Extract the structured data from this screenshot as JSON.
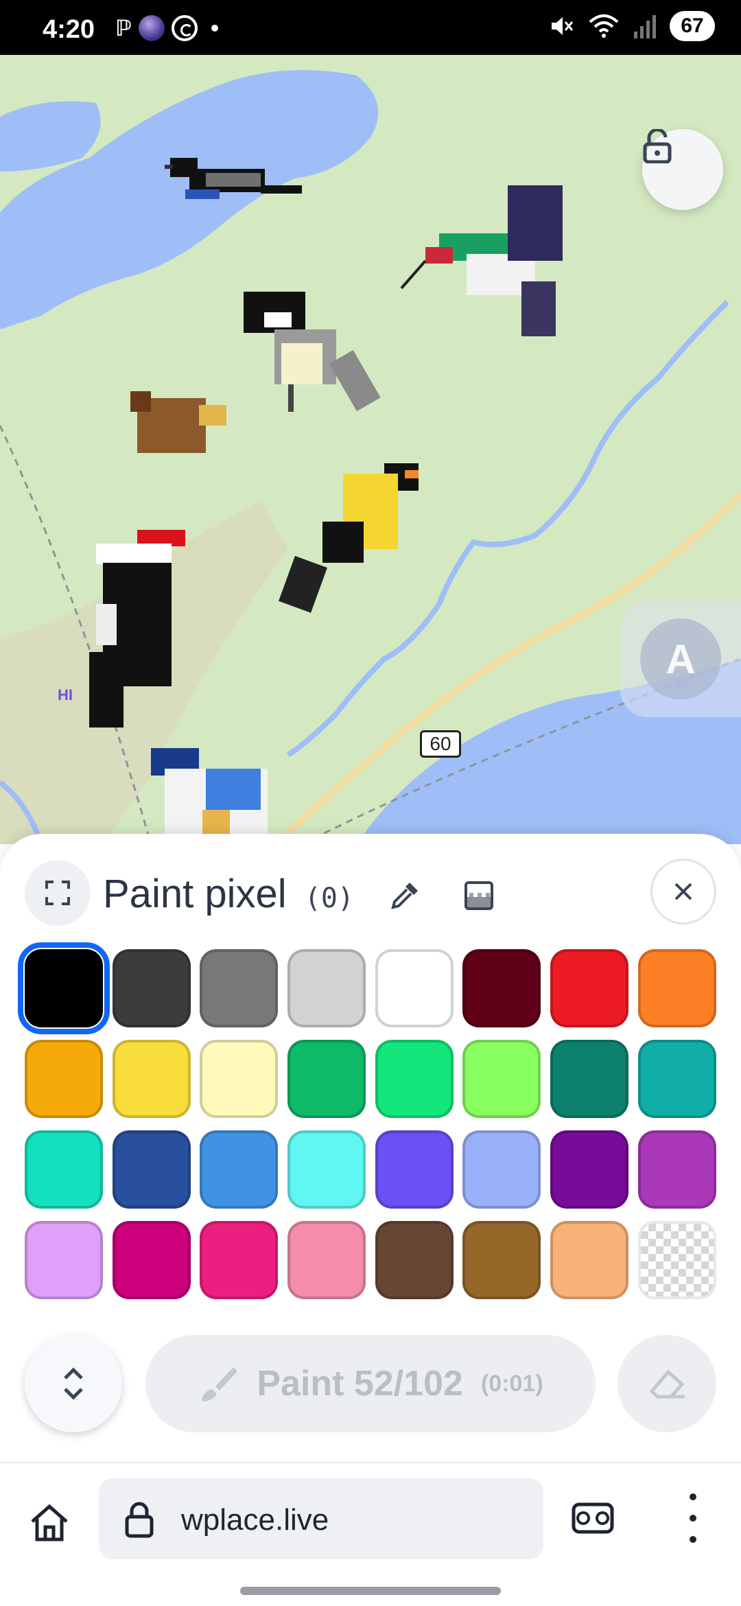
{
  "status_bar": {
    "time": "4:20",
    "left_icons": [
      "parking-icon",
      "globe-app-icon",
      "whatsapp-icon",
      "notification-dot"
    ],
    "right_icons": [
      "mute-icon",
      "wifi-icon",
      "signal-icon"
    ],
    "battery": "67"
  },
  "map": {
    "route_label": "60",
    "place_label": "HI",
    "lock_icon": "unlock-icon",
    "translate_icon": "translate-icon"
  },
  "sheet": {
    "title": "Paint pixel",
    "count": "(0)",
    "icons": [
      "expand-icon",
      "eyedropper-icon",
      "gradient-icon",
      "close-icon"
    ],
    "palette": [
      "#000000",
      "#3c3c3c",
      "#787878",
      "#d2d2d2",
      "#ffffff",
      "#600018",
      "#ed1c24",
      "#ff7f27",
      "#f6aa09",
      "#f9dd3b",
      "#fffabc",
      "#0eb968",
      "#13e67b",
      "#87ff5e",
      "#0c816e",
      "#10aea6",
      "#13e1be",
      "#28509e",
      "#4093e4",
      "#60f7f2",
      "#6b50f6",
      "#99b1fb",
      "#780c99",
      "#aa38b9",
      "#e09ff9",
      "#cb007a",
      "#ec1f80",
      "#f38da9",
      "#684634",
      "#95682a",
      "#f8b277",
      "transparent"
    ],
    "selected_index": 0
  },
  "actions": {
    "paint_label": "Paint",
    "charges": "52/102",
    "timer": "(0:01)",
    "paint_icon": "brush-icon",
    "toggle_icon": "chevron-up-down-icon",
    "eraser_icon": "eraser-icon"
  },
  "browser": {
    "url": "wplace.live",
    "home_icon": "home-icon",
    "lock_icon": "lock-icon",
    "tabs_icon": "incognito-tabs-icon",
    "menu_icon": "more-vert-icon"
  }
}
